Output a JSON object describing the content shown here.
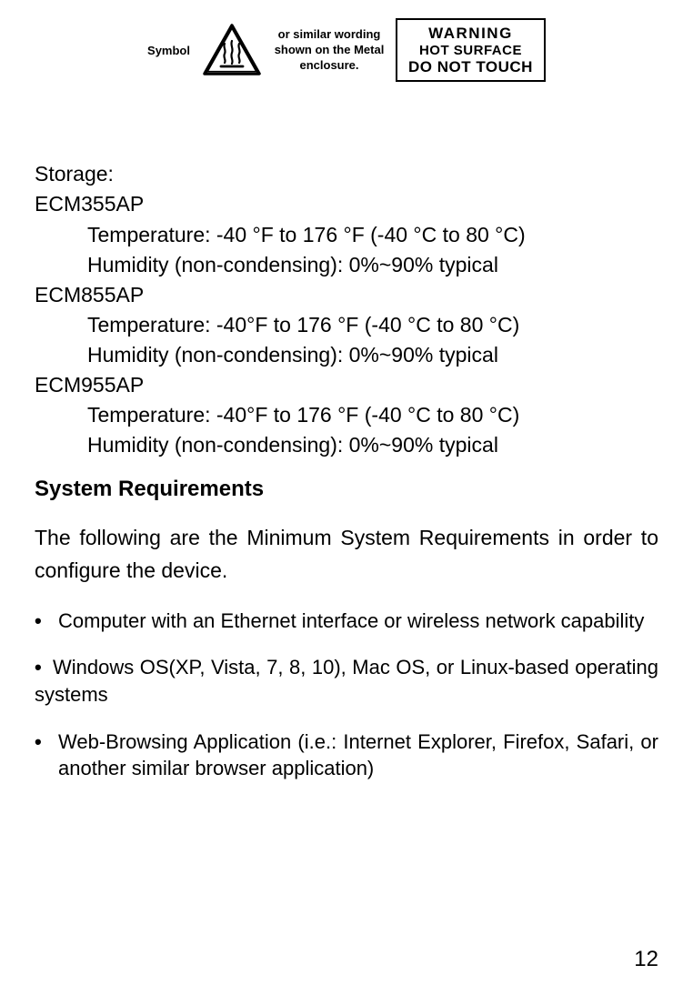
{
  "warning": {
    "symbol_label": "Symbol",
    "similar_wording": "or similar wording shown on the Metal enclosure.",
    "box_line1": "WARNING",
    "box_line2": "HOT SURFACE",
    "box_line3": "DO NOT TOUCH"
  },
  "storage": {
    "heading": "Storage:",
    "models": [
      {
        "name": "ECM355AP",
        "temperature": "Temperature: -40 °F to 176 °F (-40 °C to 80 °C)",
        "humidity": "Humidity (non-condensing): 0%~90% typical"
      },
      {
        "name": "ECM855AP",
        "temperature": "Temperature: -40°F to 176 °F (-40 °C to 80 °C)",
        "humidity": "Humidity (non-condensing): 0%~90% typical"
      },
      {
        "name": "ECM955AP",
        "temperature": "Temperature: -40°F to 176 °F (-40 °C to 80 °C)",
        "humidity": "Humidity (non-condensing): 0%~90% typical"
      }
    ]
  },
  "system_requirements": {
    "heading": "System Requirements",
    "intro": "The following are the Minimum System Requirements in order to configure the device.",
    "bullets": [
      "Computer with an Ethernet interface or wireless network capability",
      "Windows OS(XP, Vista, 7, 8, 10), Mac OS, or Linux-based operating systems",
      "Web-Browsing Application (i.e.: Internet Explorer, Firefox, Safari, or another similar browser application)"
    ]
  },
  "page_number": "12"
}
